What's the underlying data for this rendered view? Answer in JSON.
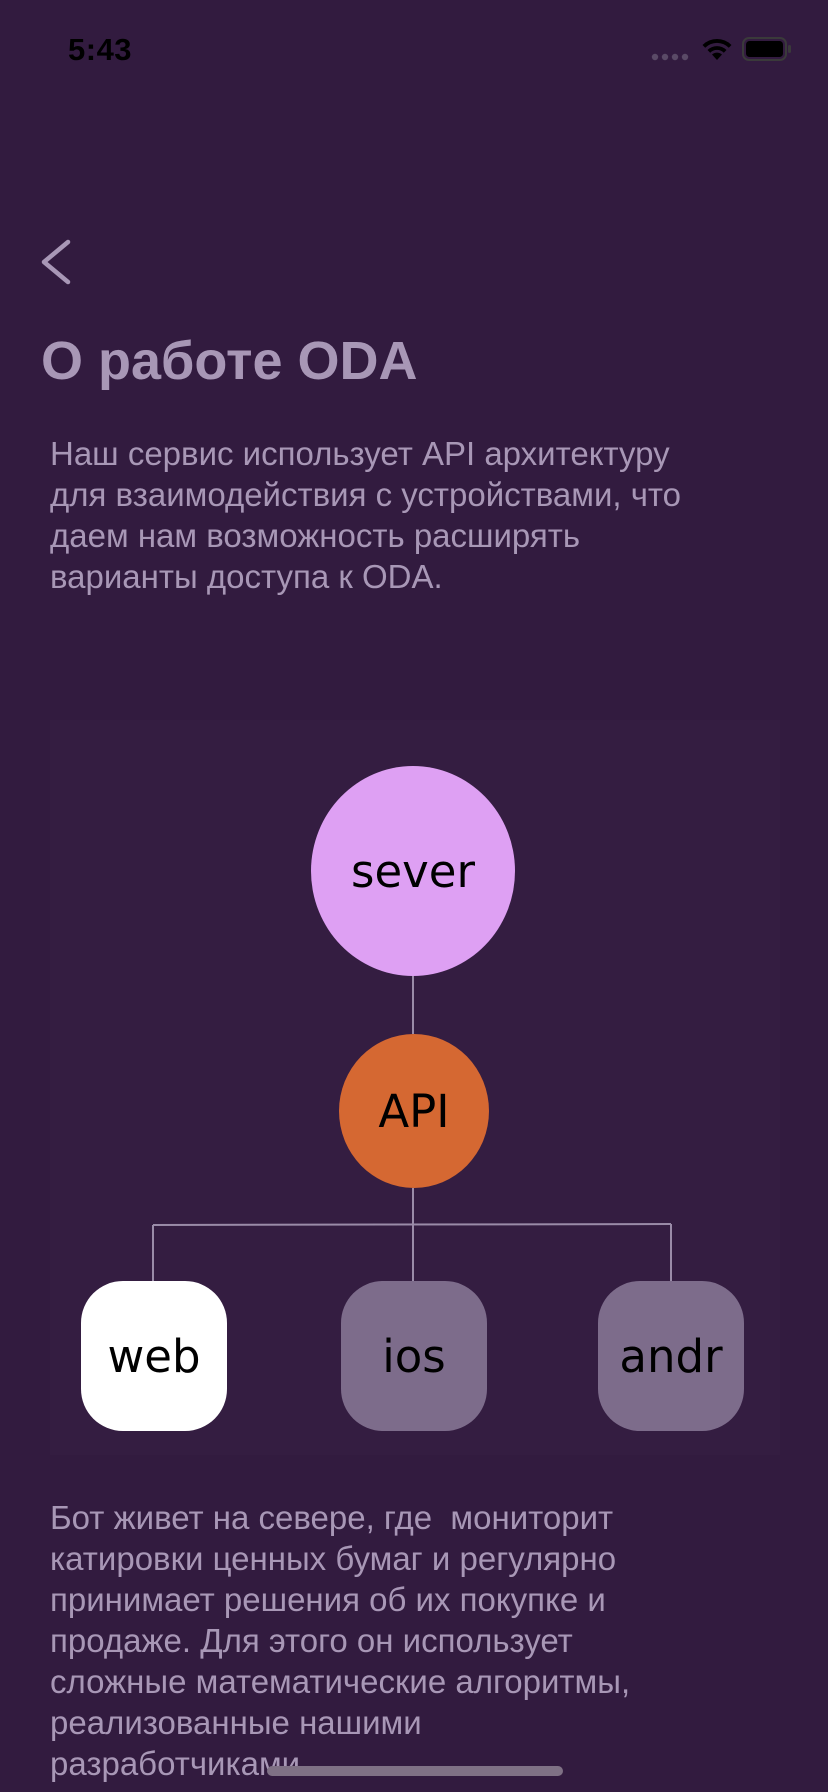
{
  "status_bar": {
    "time": "5:43",
    "icons": [
      "signal-icon",
      "wifi-icon",
      "battery-icon"
    ]
  },
  "nav": {
    "back_icon": "chevron-left-icon"
  },
  "page": {
    "title": "О работе ODA",
    "intro": "Наш сервис использует API архитектуру\nдля взаимодействия с устройствами, что\nдаем нам возможность расширять\nварианты доступа к ODA.",
    "outro": "Бот живет на севере, где  мониторит\nкатировки ценных бумаг и регулярно\nпринимает решения об их покупке и\nпродаже. Для этого он использует\nсложные математические алгоритмы,\nреализованные нашими\nразработчиками."
  },
  "diagram": {
    "server": "sever",
    "api": "API",
    "clients": [
      {
        "label": "web",
        "active": true
      },
      {
        "label": "ios",
        "active": false
      },
      {
        "label": "andr",
        "active": false
      }
    ]
  },
  "colors": {
    "background": "#321b3f",
    "text": "#a897b6",
    "server": "#dea0f3",
    "api": "#d56832",
    "client_active": "#ffffff",
    "client_inactive": "#7d6c8b"
  }
}
